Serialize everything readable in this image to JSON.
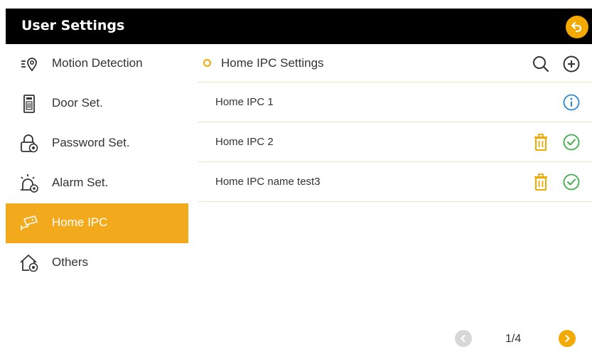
{
  "header": {
    "title": "User Settings",
    "back_icon": "back-arrow-icon"
  },
  "sidebar": {
    "items": [
      {
        "label": "Motion Detection",
        "icon": "motion-detection-icon",
        "active": false
      },
      {
        "label": "Door Set.",
        "icon": "door-icon",
        "active": false
      },
      {
        "label": "Password Set.",
        "icon": "lock-gear-icon",
        "active": false
      },
      {
        "label": "Alarm Set.",
        "icon": "alarm-icon",
        "active": false
      },
      {
        "label": "Home IPC",
        "icon": "camera-icon",
        "active": true
      },
      {
        "label": "Others",
        "icon": "home-gear-icon",
        "active": false
      }
    ]
  },
  "panel": {
    "title": "Home IPC Settings",
    "search_icon": "search-icon",
    "add_icon": "add-circle-icon",
    "rows": [
      {
        "name": "Home IPC 1",
        "actions": [
          "info-icon"
        ]
      },
      {
        "name": "Home IPC 2",
        "actions": [
          "trash-icon",
          "check-circle-icon"
        ]
      },
      {
        "name": "Home IPC name test3",
        "actions": [
          "trash-icon",
          "check-circle-icon"
        ]
      }
    ]
  },
  "pagination": {
    "text": "1/4",
    "current": 1,
    "total": 4
  },
  "colors": {
    "accent": "#f2a900",
    "active_bg": "#f2a91b",
    "titlebar_bg": "#000000",
    "info_blue": "#2a8ad8",
    "check_green": "#3fae49"
  }
}
